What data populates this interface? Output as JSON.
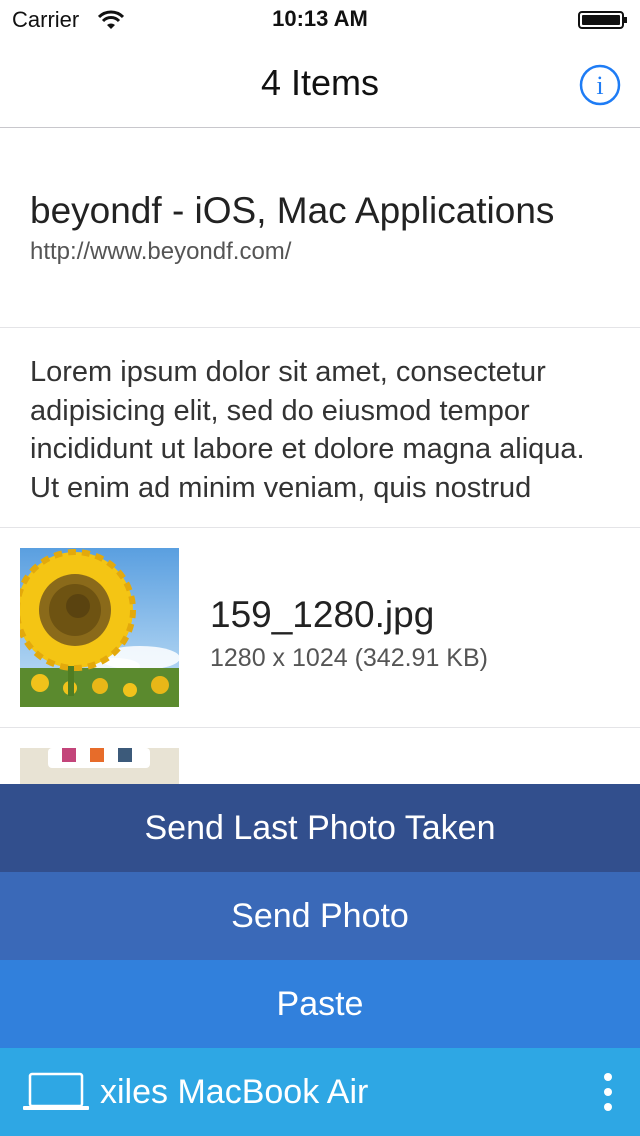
{
  "status_bar": {
    "carrier": "Carrier",
    "time": "10:13 AM",
    "wifi_icon": "wifi-icon",
    "battery_icon": "battery-icon"
  },
  "nav": {
    "title": "4 Items",
    "info_icon": "info-icon",
    "accent_color": "#1e7cf5"
  },
  "items": [
    {
      "type": "link",
      "title": "beyondf - iOS, Mac Applications",
      "url": "http://www.beyondf.com/"
    },
    {
      "type": "text",
      "text": "Lorem ipsum dolor sit amet, consectetur adipisicing elit, sed do eiusmod tempor incididunt ut labore et dolore magna aliqua. Ut enim ad minim veniam, quis nostrud"
    },
    {
      "type": "image",
      "file_name": "159_1280.jpg",
      "file_info": "1280 x 1024 (342.91 KB)",
      "thumbnail": "sunflower-thumbnail"
    },
    {
      "type": "image",
      "thumbnail": "partial-thumbnail"
    }
  ],
  "actions": {
    "send_last_photo": "Send Last Photo Taken",
    "send_photo": "Send Photo",
    "paste": "Paste"
  },
  "device_bar": {
    "device_name": "xiles MacBook Air",
    "laptop_icon": "laptop-icon",
    "more_icon": "more-vertical-icon"
  },
  "colors": {
    "action_1": "#324f8d",
    "action_2": "#3a69b8",
    "action_3": "#3180dc",
    "device_bar": "#2ea7e4"
  }
}
